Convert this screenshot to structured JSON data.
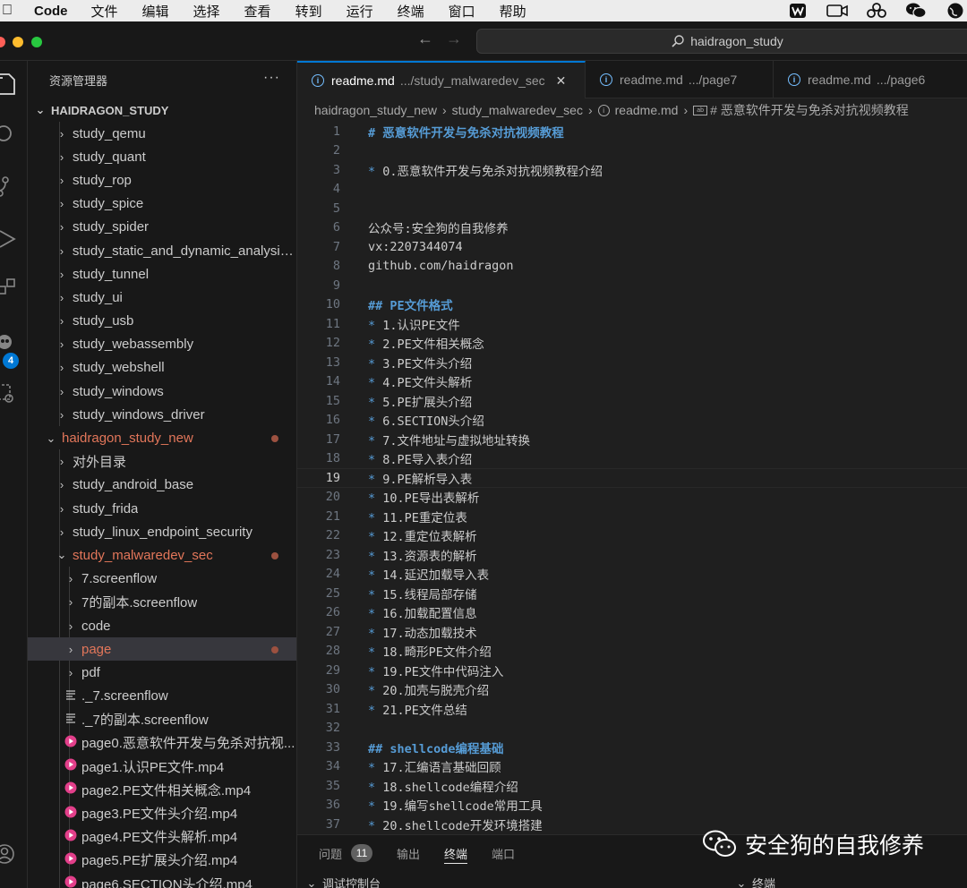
{
  "menubar": {
    "app_name": "Code",
    "items": [
      "文件",
      "编辑",
      "选择",
      "查看",
      "转到",
      "运行",
      "终端",
      "窗口",
      "帮助"
    ],
    "tray_icons": [
      "wps-icon",
      "screen-record-icon",
      "cloud-sync-icon",
      "wechat-icon",
      "globe-icon"
    ]
  },
  "titlebar": {
    "search_text": "haidragon_study",
    "back_label": "←",
    "forward_label": "→"
  },
  "activitybar": {
    "badge": "4"
  },
  "sidebar": {
    "title": "资源管理器",
    "more": "···",
    "root": "HAIDRAGON_STUDY",
    "items": [
      {
        "label": "study_qemu",
        "kind": "folder",
        "indent": 1
      },
      {
        "label": "study_quant",
        "kind": "folder",
        "indent": 1
      },
      {
        "label": "study_rop",
        "kind": "folder",
        "indent": 1
      },
      {
        "label": "study_spice",
        "kind": "folder",
        "indent": 1
      },
      {
        "label": "study_spider",
        "kind": "folder",
        "indent": 1
      },
      {
        "label": "study_static_and_dynamic_analysis...",
        "kind": "folder",
        "indent": 1
      },
      {
        "label": "study_tunnel",
        "kind": "folder",
        "indent": 1
      },
      {
        "label": "study_ui",
        "kind": "folder",
        "indent": 1
      },
      {
        "label": "study_usb",
        "kind": "folder",
        "indent": 1
      },
      {
        "label": "study_webassembly",
        "kind": "folder",
        "indent": 1
      },
      {
        "label": "study_webshell",
        "kind": "folder",
        "indent": 1
      },
      {
        "label": "study_windows",
        "kind": "folder",
        "indent": 1
      },
      {
        "label": "study_windows_driver",
        "kind": "folder",
        "indent": 1
      },
      {
        "label": "haidragon_study_new",
        "kind": "open-folder",
        "indent": 0,
        "modified": true
      },
      {
        "label": "对外目录",
        "kind": "folder",
        "indent": 1
      },
      {
        "label": "study_android_base",
        "kind": "folder",
        "indent": 1
      },
      {
        "label": "study_frida",
        "kind": "folder",
        "indent": 1
      },
      {
        "label": "study_linux_endpoint_security",
        "kind": "folder",
        "indent": 1
      },
      {
        "label": "study_malwaredev_sec",
        "kind": "open-folder",
        "indent": 1,
        "modified": true
      },
      {
        "label": "7.screenflow",
        "kind": "folder",
        "indent": 2
      },
      {
        "label": "7的副本.screenflow",
        "kind": "folder",
        "indent": 2
      },
      {
        "label": "code",
        "kind": "folder",
        "indent": 2
      },
      {
        "label": "page",
        "kind": "folder",
        "indent": 2,
        "modified": true,
        "selected": true
      },
      {
        "label": "pdf",
        "kind": "folder",
        "indent": 2
      },
      {
        "label": "._7.screenflow",
        "kind": "file",
        "indent": 2
      },
      {
        "label": "._7的副本.screenflow",
        "kind": "file",
        "indent": 2
      },
      {
        "label": "page0.恶意软件开发与免杀对抗视...",
        "kind": "video",
        "indent": 2
      },
      {
        "label": "page1.认识PE文件.mp4",
        "kind": "video",
        "indent": 2
      },
      {
        "label": "page2.PE文件相关概念.mp4",
        "kind": "video",
        "indent": 2
      },
      {
        "label": "page3.PE文件头介绍.mp4",
        "kind": "video",
        "indent": 2
      },
      {
        "label": "page4.PE文件头解析.mp4",
        "kind": "video",
        "indent": 2
      },
      {
        "label": "page5.PE扩展头介绍.mp4",
        "kind": "video",
        "indent": 2
      },
      {
        "label": "page6.SECTION头介绍.mp4",
        "kind": "video",
        "indent": 2
      }
    ]
  },
  "tabs": [
    {
      "name": "readme.md",
      "path": ".../study_malwaredev_sec",
      "active": true,
      "close": "✕"
    },
    {
      "name": "readme.md",
      "path": ".../page7",
      "active": false
    },
    {
      "name": "readme.md",
      "path": ".../page6",
      "active": false
    }
  ],
  "breadcrumb": [
    "haidragon_study_new",
    "study_malwaredev_sec",
    "readme.md",
    "# 恶意软件开发与免杀对抗视频教程"
  ],
  "editor": {
    "current_line": 19,
    "lines": [
      "# 恶意软件开发与免杀对抗视频教程",
      "",
      "* 0.恶意软件开发与免杀对抗视频教程介绍",
      "",
      "",
      "公众号:安全狗的自我修养",
      "vx:2207344074",
      "github.com/haidragon",
      "",
      "## PE文件格式",
      "* 1.认识PE文件",
      "* 2.PE文件相关概念",
      "* 3.PE文件头介绍",
      "* 4.PE文件头解析",
      "* 5.PE扩展头介绍",
      "* 6.SECTION头介绍",
      "* 7.文件地址与虚拟地址转换",
      "* 8.PE导入表介绍",
      "* 9.PE解析导入表",
      "* 10.PE导出表解析",
      "* 11.PE重定位表",
      "* 12.重定位表解析",
      "* 13.资源表的解析",
      "* 14.延迟加载导入表",
      "* 15.线程局部存储",
      "* 16.加载配置信息",
      "* 17.动态加载技术",
      "* 18.畸形PE文件介绍",
      "* 19.PE文件中代码注入",
      "* 20.加壳与脱壳介绍",
      "* 21.PE文件总结",
      "",
      "## shellcode编程基础",
      "* 17.汇编语言基础回顾",
      "* 18.shellcode编程介绍",
      "* 19.编写shellcode常用工具",
      "* 20.shellcode开发环境搭建"
    ]
  },
  "panel": {
    "tabs": [
      {
        "label": "问题",
        "badge": "11"
      },
      {
        "label": "输出"
      },
      {
        "label": "终端",
        "active": true
      },
      {
        "label": "端口"
      }
    ],
    "debug_console": "调试控制台",
    "terminal": "终端"
  },
  "watermark": {
    "text": "安全狗的自我修养"
  },
  "colors": {
    "accent": "#0078d4",
    "modified": "#e2765a",
    "markdown_heading": "#569cd6",
    "video_icon": "#e23f8a"
  }
}
